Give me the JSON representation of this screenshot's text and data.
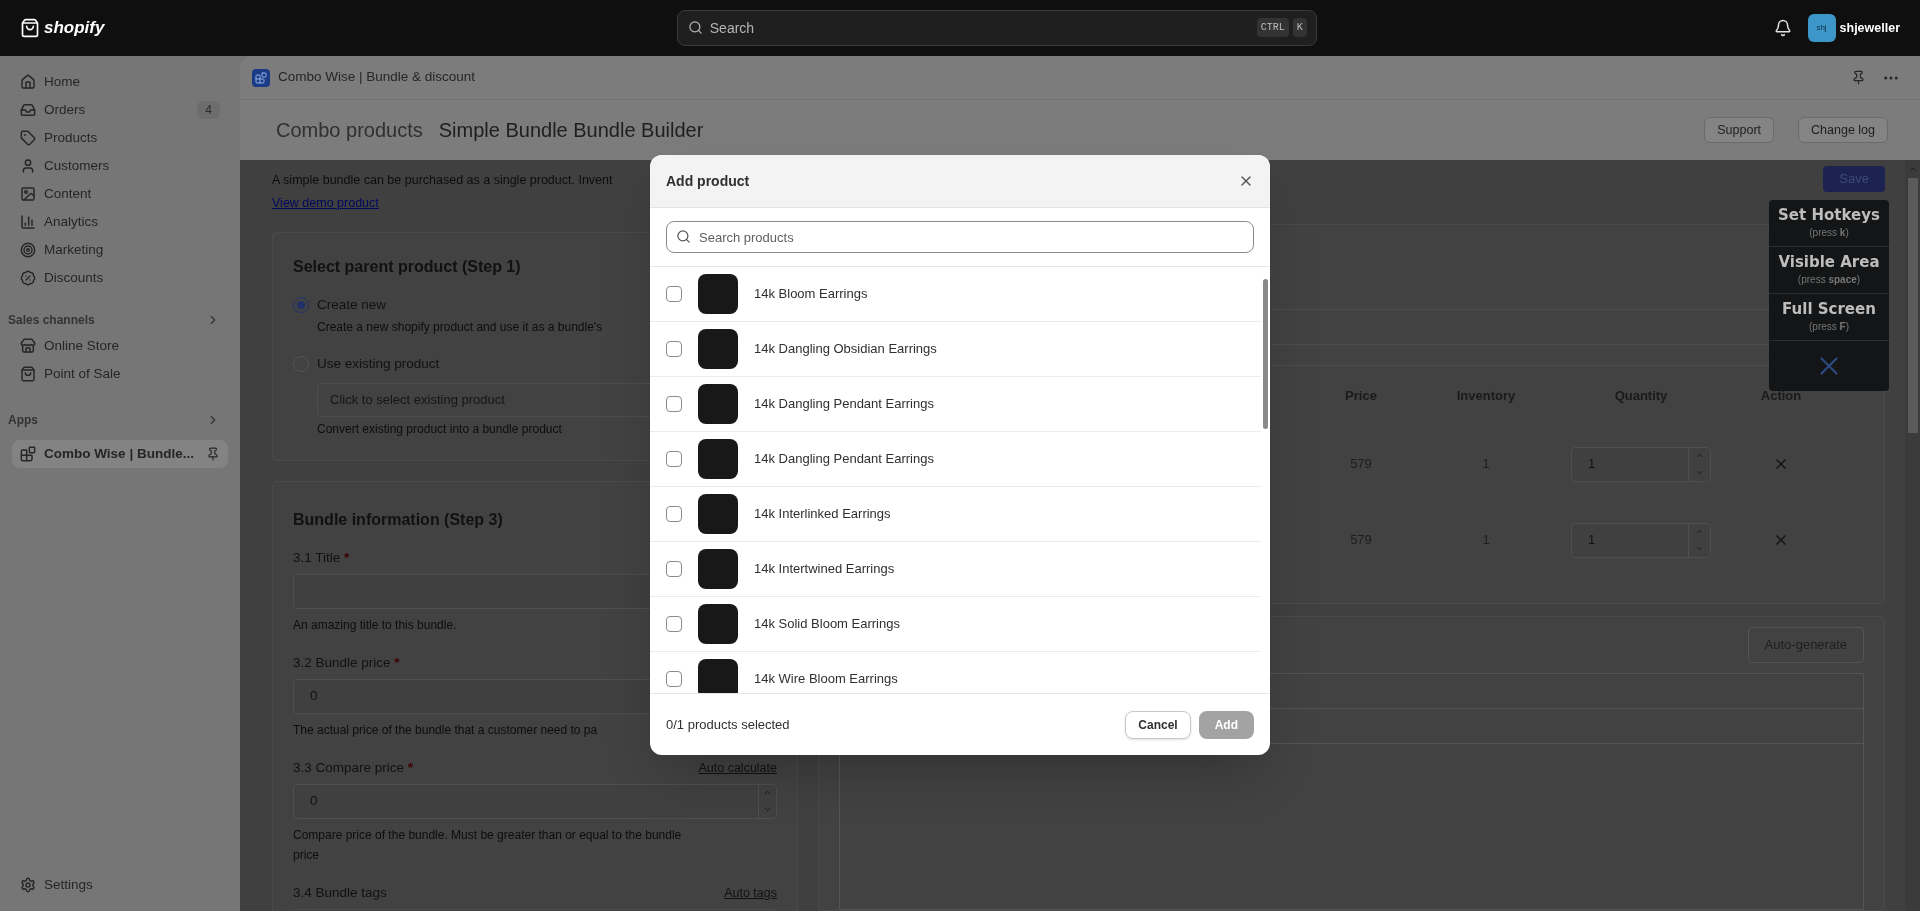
{
  "top_bar": {
    "logo": "shopify",
    "search": {
      "placeholder": "Search",
      "shortcut": [
        "CTRL",
        "K"
      ]
    },
    "account": {
      "avatar": "shj",
      "name": "shjeweller"
    }
  },
  "sidebar": {
    "items": [
      {
        "label": "Home",
        "selected": false
      },
      {
        "label": "Orders",
        "badge": "4",
        "selected": false
      },
      {
        "label": "Products",
        "selected": false
      },
      {
        "label": "Customers",
        "selected": false
      },
      {
        "label": "Content",
        "selected": false
      },
      {
        "label": "Analytics",
        "selected": false
      },
      {
        "label": "Marketing",
        "selected": false
      },
      {
        "label": "Discounts",
        "selected": false
      }
    ],
    "sections": [
      {
        "title": "Sales channels",
        "items": [
          {
            "label": "Online Store",
            "selected": false,
            "pinned": false
          },
          {
            "label": "Point of Sale",
            "selected": false,
            "pinned": false
          }
        ]
      },
      {
        "title": "Apps",
        "items": [
          {
            "label": "Combo Wise | Bundle...",
            "selected": true,
            "pinned": true
          }
        ]
      }
    ],
    "footer_items": [
      {
        "label": "Settings",
        "selected": false
      }
    ]
  },
  "app_header": {
    "title": "Combo Wise | Bundle & discount"
  },
  "page_header": {
    "breadcrumb": "Combo products",
    "title": "Simple Bundle Bundle Builder",
    "buttons": [
      "Support",
      "Change log"
    ]
  },
  "intro": {
    "text": "A simple bundle can be purchased as a single product. Invent",
    "link": "View demo product"
  },
  "parent_card": {
    "title": "Select parent product (Step 1)",
    "options": [
      {
        "label": "Create new",
        "selected": true,
        "help": "Create a new shopify product and use it as a bundle's"
      },
      {
        "label": "Use existing product",
        "selected": false,
        "placeholder": "Click to select existing product",
        "help": "Convert existing product into a bundle product"
      }
    ]
  },
  "info_card": {
    "title": "Bundle information (Step 3)",
    "fields": [
      {
        "kind": "text",
        "label": "3.1 Title",
        "required_mark": "*",
        "help": "An amazing title to this bundle."
      },
      {
        "kind": "text",
        "label": "3.2 Bundle price",
        "required_mark": "*",
        "value": "0",
        "help": "The actual price of the bundle that a customer need to pa"
      },
      {
        "kind": "number",
        "label": "3.3 Compare price",
        "required_mark": "*",
        "link": "Auto calculate",
        "value": "0",
        "help": "Compare price of the bundle. Must be greater than or equal to the bundle price"
      },
      {
        "kind": "text",
        "label": "3.4 Bundle tags",
        "link": "Auto tags"
      }
    ]
  },
  "save_button": {
    "label": "Save"
  },
  "items_table": {
    "columns": [
      "Price",
      "Inventory",
      "Quantity",
      "Action"
    ],
    "rows": [
      {
        "price": "579",
        "inventory": "1",
        "quantity": "1"
      },
      {
        "price": "579",
        "inventory": "1",
        "quantity": "1"
      }
    ]
  },
  "variants_card": {
    "button": "Auto-generate"
  },
  "hotkeys": {
    "items": [
      {
        "title": "Set Hotkeys",
        "hint": "(press **k**)"
      },
      {
        "title": "Visible Area",
        "hint": "(press **space**)"
      },
      {
        "title": "Full Screen",
        "hint": "(press **F**)"
      }
    ]
  },
  "modal": {
    "title": "Add product",
    "search": {
      "placeholder": "Search products"
    },
    "products": [
      {
        "name": "14k Bloom Earrings",
        "checked": false
      },
      {
        "name": "14k Dangling Obsidian Earrings",
        "checked": false
      },
      {
        "name": "14k Dangling Pendant Earrings",
        "checked": false
      },
      {
        "name": "14k Dangling Pendant Earrings",
        "checked": false
      },
      {
        "name": "14k Interlinked Earrings",
        "checked": false
      },
      {
        "name": "14k Intertwined Earrings",
        "checked": false
      },
      {
        "name": "14k Solid Bloom Earrings",
        "checked": false
      },
      {
        "name": "14k Wire Bloom Earrings",
        "checked": false
      }
    ],
    "footer": {
      "count": "0/1 products selected",
      "cancel": "Cancel",
      "add": {
        "label": "Add",
        "disabled": true
      }
    }
  }
}
